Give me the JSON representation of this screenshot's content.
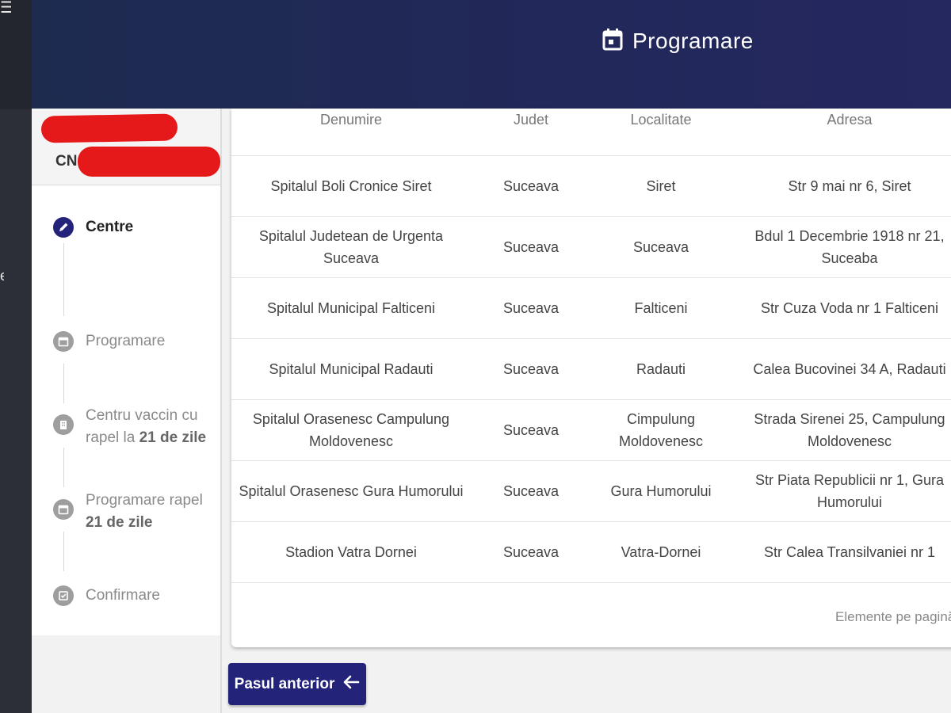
{
  "header": {
    "title": "Programare"
  },
  "leftbar": {
    "side_letter": "e"
  },
  "user": {
    "cnp_prefix": "CN"
  },
  "steps": [
    {
      "label": "Centre"
    },
    {
      "label": "Programare"
    },
    {
      "label_pre": "Centru vaccin cu",
      "label_mid": "rapel la ",
      "label_bold": "21 de zile"
    },
    {
      "label_pre": "Programare rapel",
      "label_bold": "21 de zile"
    },
    {
      "label": "Confirmare"
    }
  ],
  "table": {
    "columns": [
      "Denumire",
      "Judet",
      "Localitate",
      "Adresa"
    ],
    "rows": [
      {
        "denumire": "Spitalul Boli Cronice Siret",
        "judet": "Suceava",
        "localitate": "Siret",
        "adresa": "Str 9 mai nr 6, Siret"
      },
      {
        "denumire": "Spitalul Judetean de Urgenta Suceava",
        "judet": "Suceava",
        "localitate": "Suceava",
        "adresa": "Bdul 1 Decembrie 1918 nr 21, Suceaba"
      },
      {
        "denumire": "Spitalul Municipal Falticeni",
        "judet": "Suceava",
        "localitate": "Falticeni",
        "adresa": "Str Cuza Voda nr 1 Falticeni"
      },
      {
        "denumire": "Spitalul Municipal Radauti",
        "judet": "Suceava",
        "localitate": "Radauti",
        "adresa": "Calea Bucovinei 34 A, Radauti"
      },
      {
        "denumire": "Spitalul Orasenesc Campulung Moldovenesc",
        "judet": "Suceava",
        "localitate": "Cimpulung Moldovenesc",
        "adresa": "Strada Sirenei 25, Campulung Moldovenesc"
      },
      {
        "denumire": "Spitalul Orasenesc Gura Humorului",
        "judet": "Suceava",
        "localitate": "Gura Humorului",
        "adresa": "Str Piata Republicii nr 1, Gura Humorului"
      },
      {
        "denumire": "Stadion Vatra Dornei",
        "judet": "Suceava",
        "localitate": "Vatra-Dornei",
        "adresa": "Str Calea Transilvaniei nr 1"
      }
    ]
  },
  "paginator": {
    "label": "Elemente pe pagină"
  },
  "buttons": {
    "back_label": "Pasul anterior"
  },
  "colors": {
    "primary": "#23237a",
    "header_start": "#1d2b4f",
    "header_end": "#25275f",
    "redaction": "#e51919"
  },
  "icons": {
    "header": "calendar-icon",
    "menu": "menu-icon",
    "step_active": "pencil-icon",
    "step_calendar": "calendar-icon",
    "step_building": "building-icon",
    "step_confirm": "checkbox-icon",
    "back": "arrow-left-icon"
  }
}
